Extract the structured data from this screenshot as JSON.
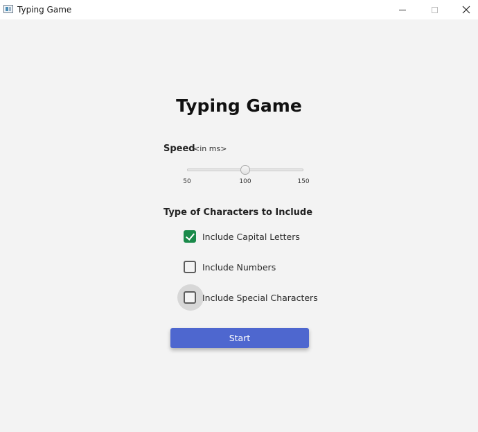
{
  "window": {
    "title": "Typing Game",
    "icon": "app-window-icon"
  },
  "main": {
    "heading": "Typing Game",
    "speed": {
      "label": "Speed",
      "unit": "<in ms>",
      "min": 50,
      "max": 150,
      "value": 100,
      "ticks": [
        "50",
        "100",
        "150"
      ]
    },
    "characters": {
      "label": "Type of Characters to Include",
      "options": [
        {
          "label": "Include Capital Letters",
          "checked": true
        },
        {
          "label": "Include Numbers",
          "checked": false
        },
        {
          "label": "Include Special Characters",
          "checked": false,
          "focused": true
        }
      ]
    },
    "start_label": "Start"
  },
  "colors": {
    "accent": "#4e67cf",
    "check": "#1a8a4a",
    "background": "#f3f3f3"
  }
}
